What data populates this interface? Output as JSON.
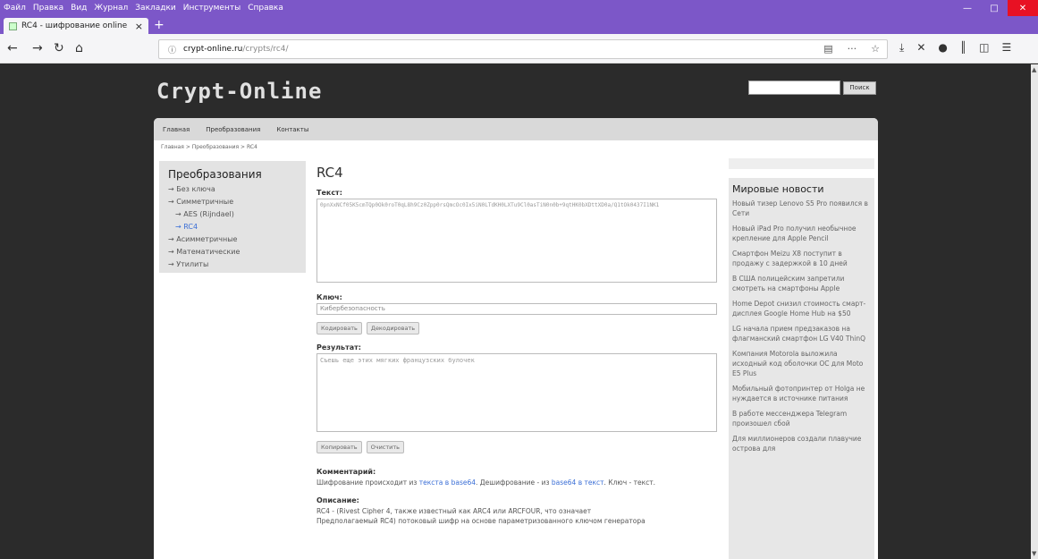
{
  "menu": [
    "Файл",
    "Правка",
    "Вид",
    "Журнал",
    "Закладки",
    "Инструменты",
    "Справка"
  ],
  "tab": {
    "title": "RC4 - шифрование online",
    "close": "×",
    "new": "+"
  },
  "nav": {
    "url_host": "crypt-online.ru",
    "url_path": "/crypts/rc4/",
    "more": "···"
  },
  "site": {
    "logo": "Crypt-Online",
    "search_button": "Поиск",
    "topnav": [
      "Главная",
      "Преобразования",
      "Контакты"
    ],
    "breadcrumb": "Главная > Преобразования > RC4"
  },
  "sidebar": {
    "title": "Преобразования",
    "items": [
      {
        "label": "→ Без ключа"
      },
      {
        "label": "→ Симметричные"
      },
      {
        "label": "→ AES (Rijndael)"
      },
      {
        "label": "→ RC4"
      },
      {
        "label": "→ Асимметричные"
      },
      {
        "label": "→ Математические"
      },
      {
        "label": "→ Утилиты"
      }
    ]
  },
  "main": {
    "title": "RC4",
    "text_label": "Текст:",
    "text_value": "0pnXxNCf05K5cmTQp0Ok0roT0qL8h9Cz0Zpp0rsQmcOc0Ix5iN0LTdKH0LXTu9Cl0asTiN0n0b+9qtHK0bXDttXD0a/Q1tOk0437I1NK1",
    "key_label": "Ключ:",
    "key_value": "Кибербезопасность",
    "encode_button": "Кодировать",
    "decode_button": "Декодировать",
    "result_label": "Результат:",
    "result_value": "Съешь еще этих мягких французских булочек",
    "copy_button": "Копировать",
    "clear_button": "Очистить",
    "comment_label": "Комментарий:",
    "comment_1": "Шифрование происходит из",
    "comment_link1": "текста в base64",
    "comment_2": ". Дешифрование - из",
    "comment_link2": "base64 в текст",
    "comment_3": ". Ключ - текст.",
    "desc_label": "Описание:",
    "desc_1": "RC4 - (Rivest Cipher 4, также известный как ARC4 или ARCFOUR, что означает",
    "desc_2": "Предполагаемый RC4) потоковый шифр на основе параметризованного ключом генератора"
  },
  "news": {
    "title": "Мировые новости",
    "items": [
      "Новый тизер Lenovo S5 Pro появился в Сети",
      "Новый iPad Pro получил необычное крепление для Apple Pencil",
      "Смартфон Meizu X8 поступит в продажу с задержкой в 10 дней",
      "В США полицейским запретили смотреть на смартфоны Apple",
      "Home Depot снизил стоимость смарт-дисплея Google Home Hub на $50",
      "LG начала прием предзаказов на флагманский смартфон LG V40 ThinQ",
      "Компания Motorola выложила исходный код оболочки ОС для Moto E5 Plus",
      "Мобильный фотопринтер от Holga не нуждается в источнике питания",
      "В работе мессенджера Telegram произошел сбой",
      "Для миллионеров создали плавучие острова для"
    ]
  }
}
